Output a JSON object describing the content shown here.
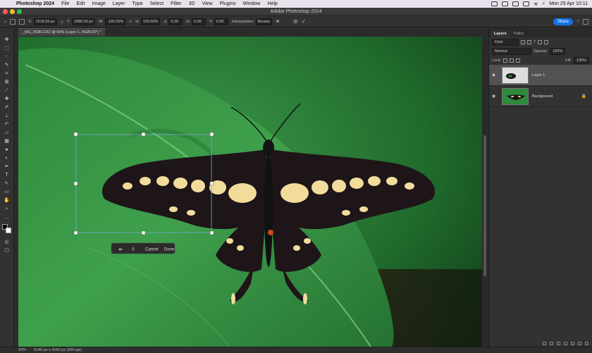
{
  "menubar": {
    "app_name": "Photoshop 2024",
    "items": [
      "File",
      "Edit",
      "Image",
      "Layer",
      "Type",
      "Select",
      "Filter",
      "3D",
      "View",
      "Plugins",
      "Window",
      "Help"
    ],
    "clock": "Mon 29 Apr  10:11"
  },
  "window": {
    "title": "Adobe Photoshop 2024"
  },
  "options": {
    "x_label": "X:",
    "x_value": "1518.99 px",
    "y_label": "Y:",
    "y_value": "2080.00 px",
    "w_label": "W:",
    "w_value": "-100.00%",
    "h_label": "H:",
    "h_value": "100.00%",
    "angle_value": "0.00",
    "h2_label": "H:",
    "h2_value": "0.00",
    "v_label": "V:",
    "v_value": "0.00",
    "interp_label": "Interpolation:",
    "interp_value": "Bicubic",
    "share_label": "Share"
  },
  "document": {
    "tab_title": "_MG_0936.CR2 @ 50% (Layer 1, RGB/16*) *"
  },
  "tools": [
    "move-icon",
    "marquee-icon",
    "lasso-icon",
    "quick-select-icon",
    "crop-icon",
    "frame-icon",
    "eyedropper-icon",
    "healing-icon",
    "brush-icon",
    "stamp-icon",
    "history-brush-icon",
    "eraser-icon",
    "gradient-icon",
    "blur-icon",
    "dodge-icon",
    "pen-icon",
    "type-icon",
    "path-select-icon",
    "rectangle-icon",
    "hand-icon",
    "zoom-icon",
    "more-icon"
  ],
  "transform_bar": {
    "cancel_label": "Cancel",
    "done_label": "Done"
  },
  "status": {
    "zoom": "50%",
    "doc_info": "6240 px x 4160 px (300 ppi)"
  },
  "layers_panel": {
    "tabs": [
      "Layers",
      "Paths"
    ],
    "search_placeholder": "Kind",
    "blend_mode": "Normal",
    "opacity_label": "Opacity:",
    "opacity_value": "100%",
    "lock_label": "Lock:",
    "fill_label": "Fill:",
    "fill_value": "100%",
    "layers": [
      {
        "name": "Layer 1",
        "selected": true
      },
      {
        "name": "Background",
        "selected": false
      }
    ]
  },
  "colors": {
    "accent": "#1473e6",
    "leaf": "#2e8b3e",
    "wing_dark": "#1e1518",
    "wing_spot": "#f2dc9c"
  }
}
